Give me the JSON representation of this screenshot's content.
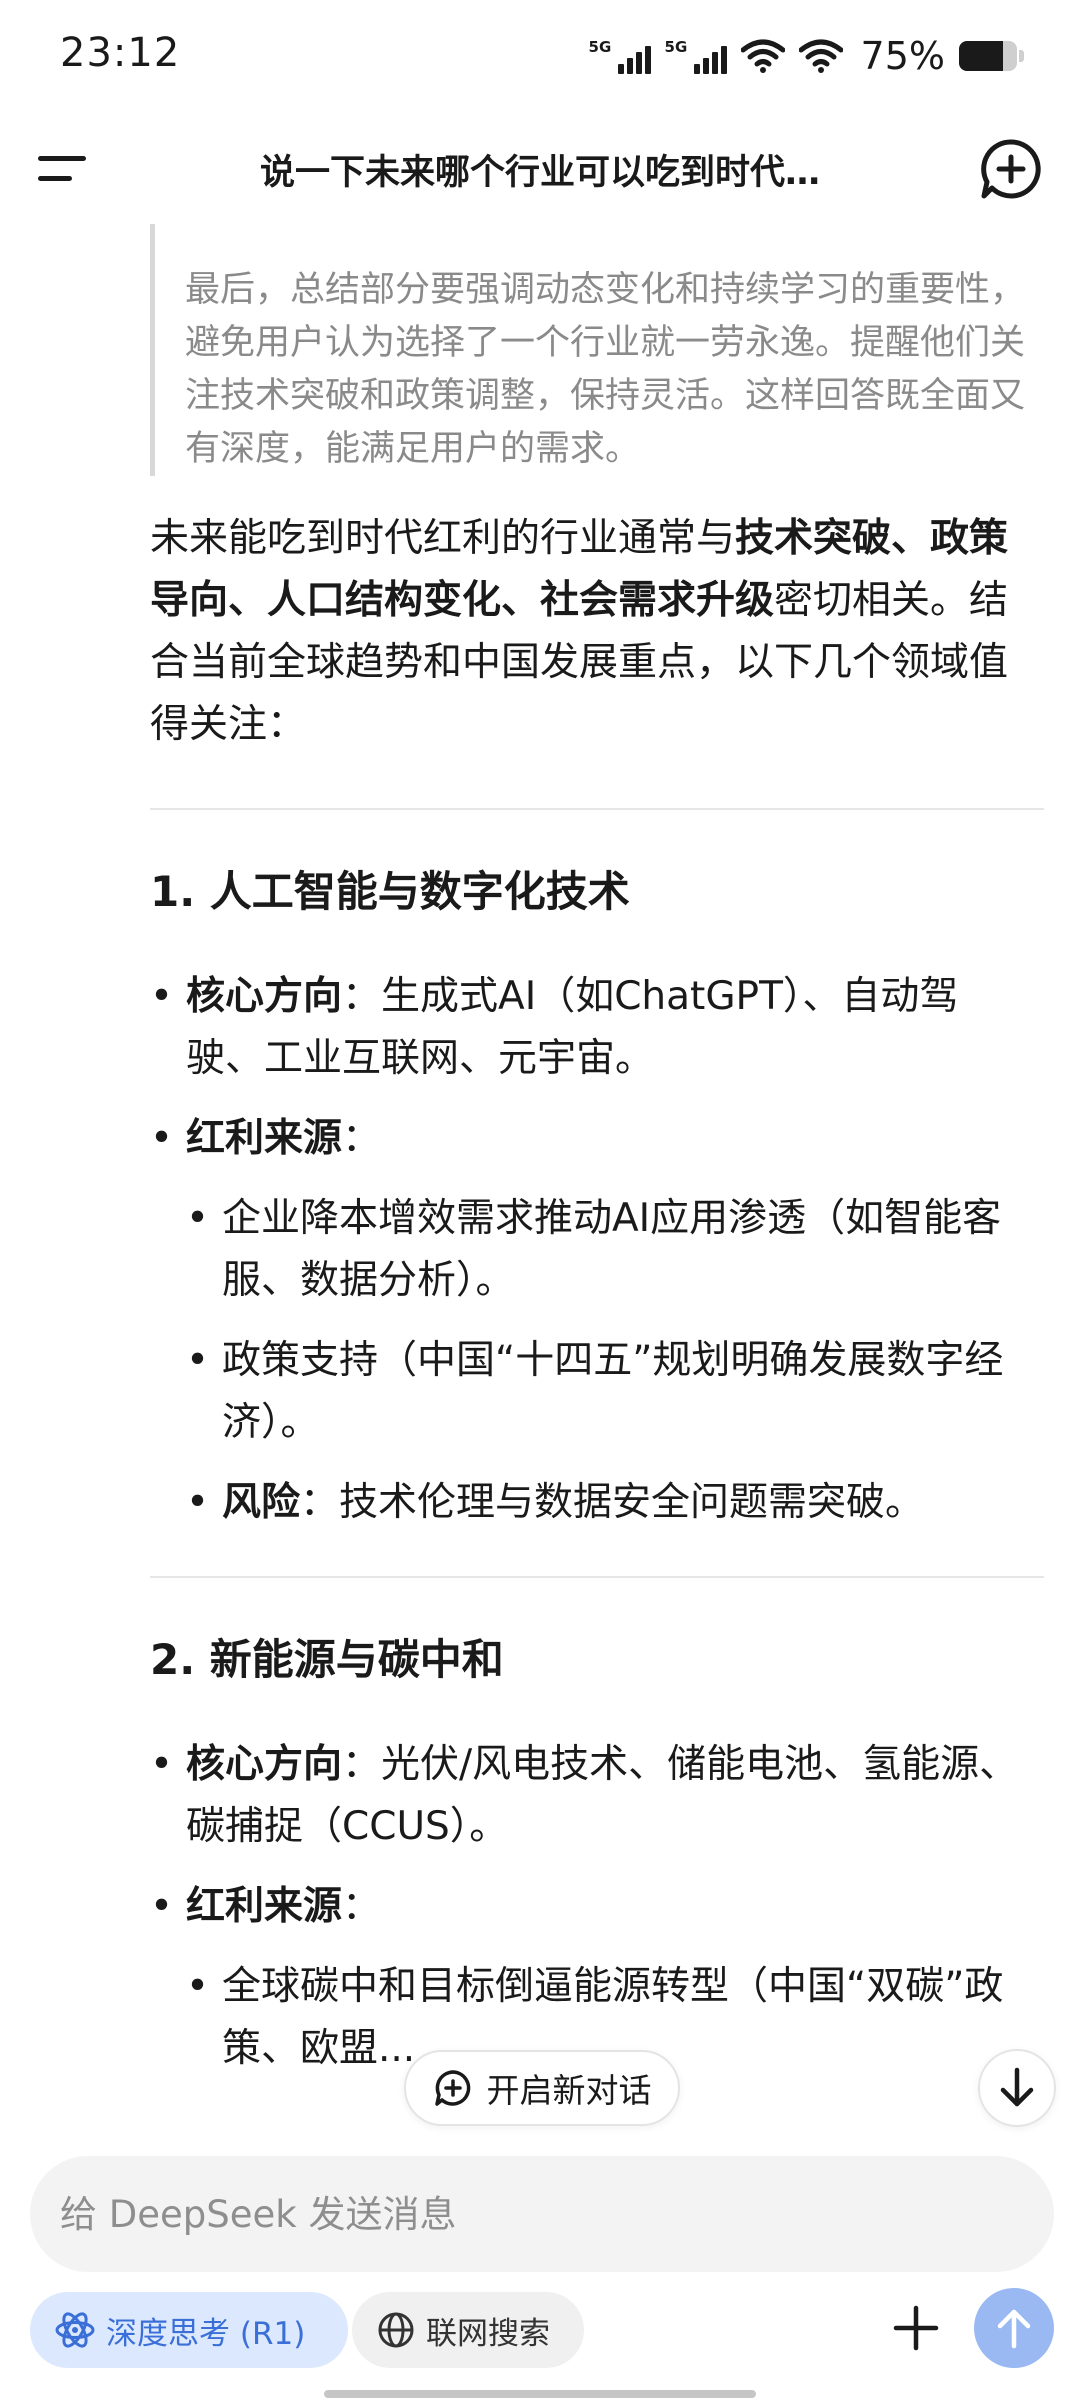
{
  "status_bar": {
    "time": "23:12",
    "signal1_label": "5G",
    "signal2_label": "5G",
    "battery_text": "75%",
    "battery_level": 0.75,
    "icons": [
      "signal-5g-icon",
      "signal-5g-icon",
      "wifi-icon",
      "wifi-icon",
      "battery-icon"
    ]
  },
  "header": {
    "title": "说一下未来哪个行业可以吃到时代…",
    "menu_icon": "menu-icon",
    "new_chat_icon": "new-chat-icon"
  },
  "thinking": {
    "text": "最后，总结部分要强调动态变化和持续学习的重要性，避免用户认为选择了一个行业就一劳永逸。提醒他们关注技术突破和政策调整，保持灵活。这样回答既全面又有深度，能满足用户的需求。"
  },
  "answer": {
    "intro_prefix": "未来能吃到时代红利的行业通常与",
    "intro_bold": "技术突破、政策导向、人口结构变化、社会需求升级",
    "intro_suffix": "密切相关。结合当前全球趋势和中国发展重点，以下几个领域值得关注：",
    "section1": {
      "heading": "1. 人工智能与数字化技术",
      "core_label": "核心方向",
      "core_text": "：生成式AI（如ChatGPT）、自动驾驶、工业互联网、元宇宙。",
      "benefit_label": "红利来源",
      "benefit_colon": "：",
      "sub1": "企业降本增效需求推动AI应用渗透（如智能客服、数据分析）。",
      "sub2": "政策支持（中国“十四五”规划明确发展数字经济）。",
      "risk_label": "风险",
      "risk_text": "：技术伦理与数据安全问题需突破。"
    },
    "section2": {
      "heading": "2. 新能源与碳中和",
      "core_label": "核心方向",
      "core_text": "：光伏/风电技术、储能电池、氢能源、碳捕捉（CCUS）。",
      "benefit_label": "红利来源",
      "benefit_colon": "：",
      "sub1": "全球碳中和目标倒逼能源转型（中国“双碳”政策、欧盟..."
    }
  },
  "floating": {
    "new_chat_label": "开启新对话",
    "scroll_icon": "arrow-down-icon"
  },
  "input": {
    "placeholder": "给 DeepSeek 发送消息"
  },
  "chips": {
    "deep_think": "深度思考 (R1)",
    "web_search": "联网搜索"
  },
  "colors": {
    "accent_blue": "#3b6fd8",
    "chip_blue_bg": "#dbe8fd",
    "send_button": "#9ab9f2",
    "thinking_text": "#8a8a8a"
  }
}
